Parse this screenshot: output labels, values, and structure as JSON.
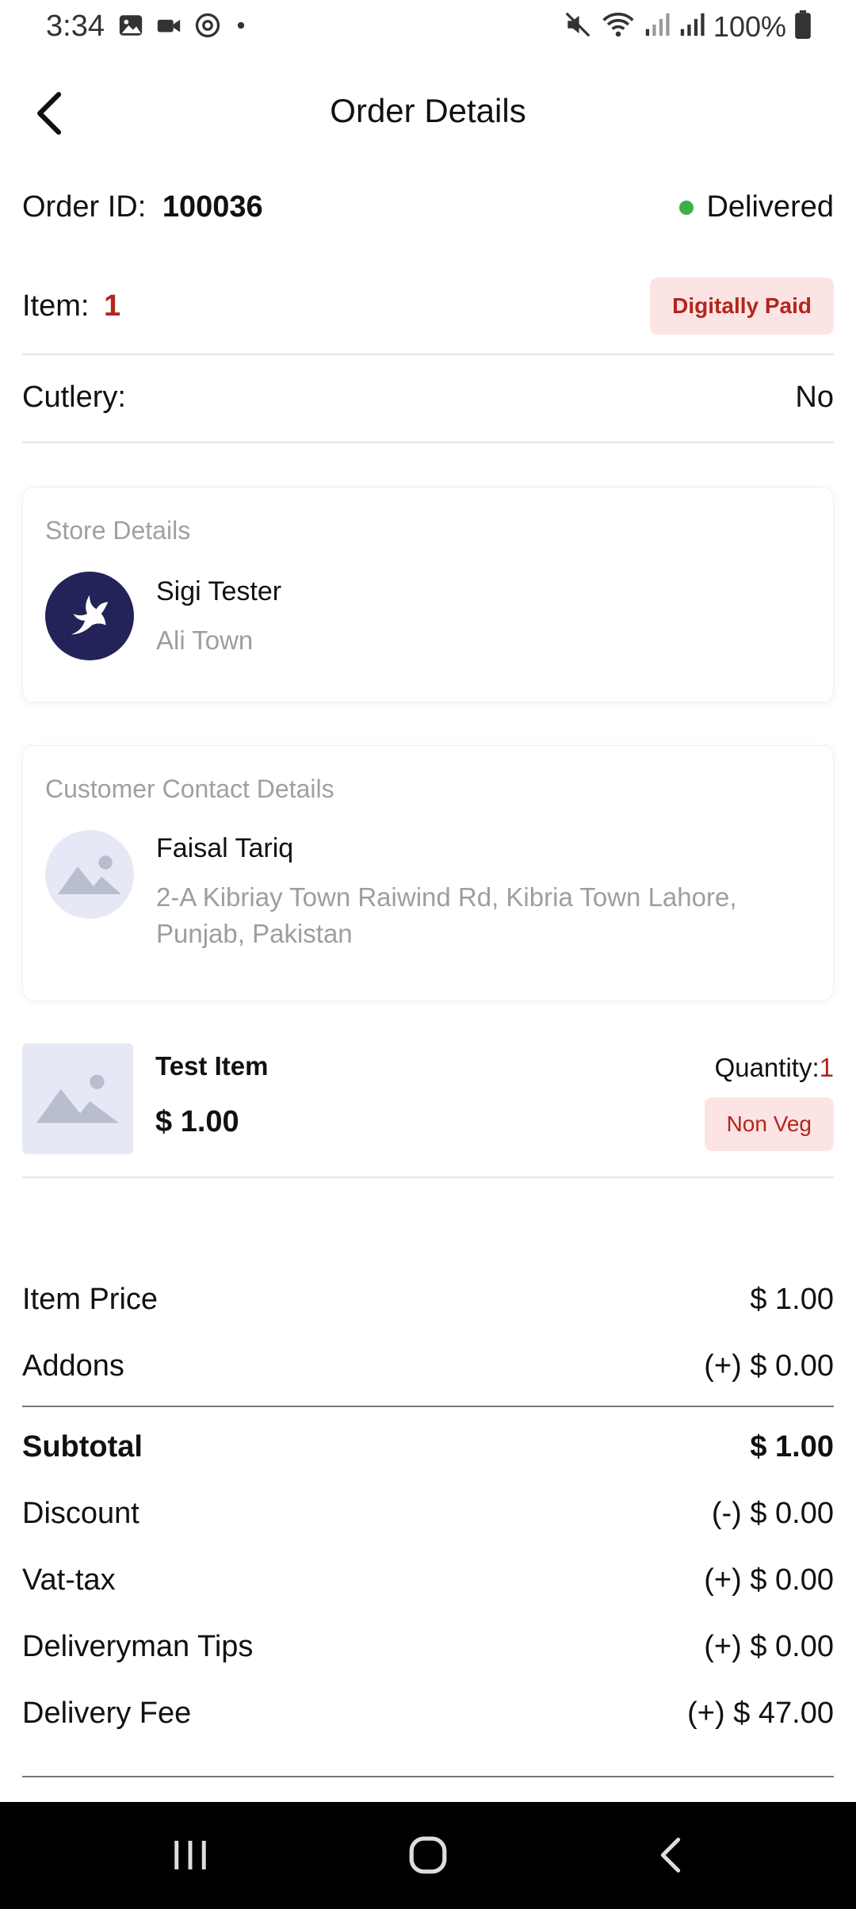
{
  "status_bar": {
    "time": "3:34",
    "battery_pct": "100%",
    "left_icons": [
      "image-icon",
      "video-icon",
      "sync-icon",
      "dot-icon"
    ],
    "right_icons": [
      "mute-icon",
      "wifi-icon",
      "signal-icon",
      "signal-icon",
      "battery-icon"
    ]
  },
  "header": {
    "title": "Order Details"
  },
  "order": {
    "id_label": "Order ID:",
    "id_value": "100036",
    "status": "Delivered",
    "status_color": "#3cae4a",
    "item_label": "Item:",
    "item_count": "1",
    "payment_badge": "Digitally Paid",
    "cutlery_label": "Cutlery:",
    "cutlery_value": "No"
  },
  "store": {
    "section_title": "Store Details",
    "name": "Sigi Tester",
    "location": "Ali Town",
    "logo_color": "#23235a"
  },
  "customer": {
    "section_title": "Customer Contact Details",
    "name": "Faisal Tariq",
    "address": "2-A Kibriay Town Raiwind Rd, Kibria Town Lahore, Punjab, Pakistan"
  },
  "item": {
    "name": "Test Item",
    "price": "$ 1.00",
    "quantity_label": "Quantity:",
    "quantity_value": "1",
    "tag": "Non Veg"
  },
  "summary": {
    "item_price_label": "Item Price",
    "item_price_value": "$ 1.00",
    "addons_label": "Addons",
    "addons_value": "(+) $ 0.00",
    "subtotal_label": "Subtotal",
    "subtotal_value": "$ 1.00",
    "discount_label": "Discount",
    "discount_value": "(-) $ 0.00",
    "vat_label": "Vat-tax",
    "vat_value": "(+) $ 0.00",
    "tips_label": "Deliveryman Tips",
    "tips_value": "(+) $ 0.00",
    "delivery_label": "Delivery Fee",
    "delivery_value": "(+) $ 47.00"
  },
  "colors": {
    "accent_red": "#b3261e",
    "badge_bg": "#fde4e4",
    "placeholder_bg": "#e6e9f5"
  },
  "nav_bar": {
    "icons": [
      "recent-apps-icon",
      "home-icon",
      "back-icon"
    ]
  }
}
